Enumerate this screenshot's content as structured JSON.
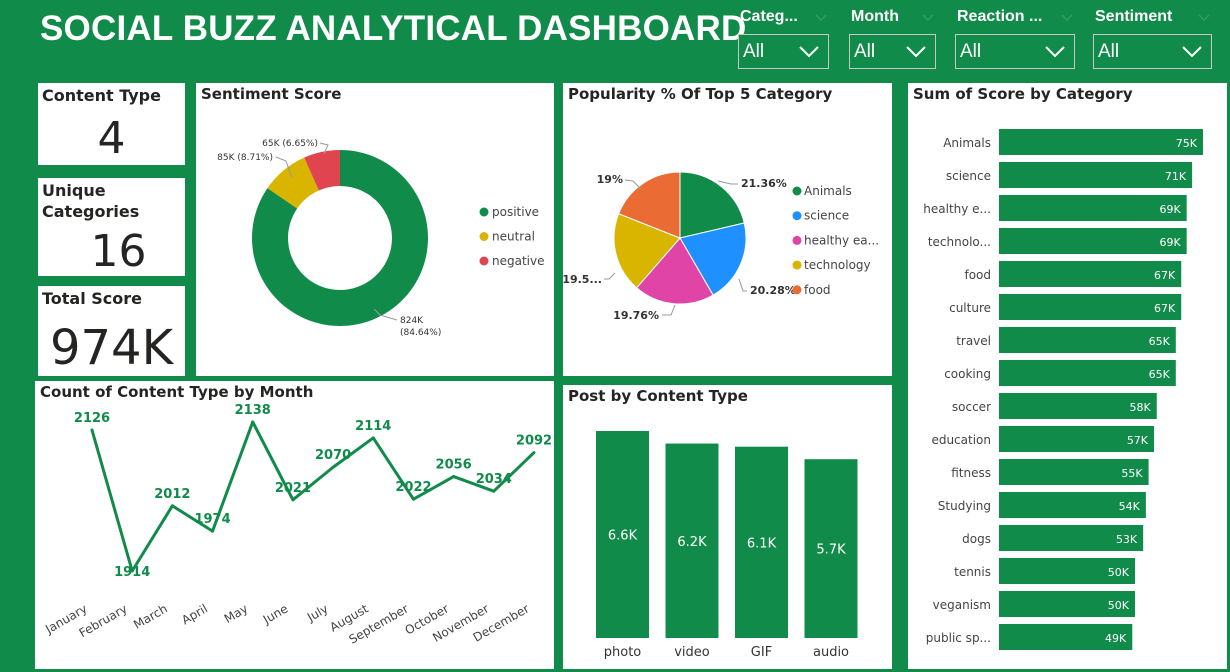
{
  "header": {
    "title": "SOCIAL BUZZ ANALYTICAL DASHBOARD"
  },
  "slicers": [
    {
      "label": "Categ...",
      "value": "All"
    },
    {
      "label": "Month",
      "value": "All"
    },
    {
      "label": "Reaction ...",
      "value": "All"
    },
    {
      "label": "Sentiment",
      "value": "All"
    }
  ],
  "cards": {
    "content_type": {
      "title": "Content Type",
      "value": "4"
    },
    "unique_categories": {
      "title": "Unique Categories",
      "value": "16"
    },
    "total_score": {
      "title": "Total Score",
      "value": "974K"
    }
  },
  "chart_data": [
    {
      "type": "donut",
      "title": "Sentiment Score",
      "slices": [
        {
          "name": "positive",
          "value": 824,
          "percent": 84.64,
          "label": "824K (84.64%)",
          "color": "#118b4a"
        },
        {
          "name": "neutral",
          "value": 85,
          "percent": 8.71,
          "label": "85K (8.71%)",
          "color": "#dab500"
        },
        {
          "name": "negative",
          "value": 65,
          "percent": 6.65,
          "label": "65K (6.65%)",
          "color": "#e0454f"
        }
      ],
      "legend_position": "right"
    },
    {
      "type": "pie",
      "title": "Popularity % Of Top 5 Category",
      "slices": [
        {
          "name": "Animals",
          "legend": "Animals",
          "percent": 21.36,
          "label": "21.36%",
          "color": "#118b4a"
        },
        {
          "name": "science",
          "legend": "science",
          "percent": 20.28,
          "label": "20.28%",
          "color": "#1e90ff"
        },
        {
          "name": "healthy eating",
          "legend": "healthy ea...",
          "percent": 19.76,
          "label": "19.76%",
          "color": "#e044a7"
        },
        {
          "name": "technology",
          "legend": "technology",
          "percent": 19.6,
          "label": "19.5...",
          "color": "#dab500"
        },
        {
          "name": "food",
          "legend": "food",
          "percent": 19.0,
          "label": "19%",
          "color": "#eb6b34"
        }
      ],
      "legend_position": "right"
    },
    {
      "type": "bar",
      "orientation": "horizontal",
      "title": "Sum of Score by Category",
      "categories": [
        "Animals",
        "science",
        "healthy e...",
        "technolo...",
        "food",
        "culture",
        "travel",
        "cooking",
        "soccer",
        "education",
        "fitness",
        "Studying",
        "dogs",
        "tennis",
        "veganism",
        "public sp..."
      ],
      "values": [
        75,
        71,
        69,
        69,
        67,
        67,
        65,
        65,
        58,
        57,
        55,
        54,
        53,
        50,
        50,
        49
      ],
      "data_labels": [
        "75K",
        "71K",
        "69K",
        "69K",
        "67K",
        "67K",
        "65K",
        "65K",
        "58K",
        "57K",
        "55K",
        "54K",
        "53K",
        "50K",
        "50K",
        "49K"
      ],
      "unit": "K",
      "color": "#118b4a"
    },
    {
      "type": "line",
      "title": "Count of Content Type by Month",
      "x": [
        "January",
        "February",
        "March",
        "April",
        "May",
        "June",
        "July",
        "August",
        "September",
        "October",
        "November",
        "December"
      ],
      "values": [
        2126,
        1914,
        2012,
        1974,
        2138,
        2021,
        2070,
        2114,
        2022,
        2056,
        2034,
        2092
      ],
      "color": "#118b4a"
    },
    {
      "type": "bar",
      "orientation": "vertical",
      "title": "Post by Content Type",
      "categories": [
        "photo",
        "video",
        "GIF",
        "audio"
      ],
      "values": [
        6.6,
        6.2,
        6.1,
        5.7
      ],
      "data_labels": [
        "6.6K",
        "6.2K",
        "6.1K",
        "5.7K"
      ],
      "unit": "K",
      "color": "#118b4a"
    }
  ]
}
